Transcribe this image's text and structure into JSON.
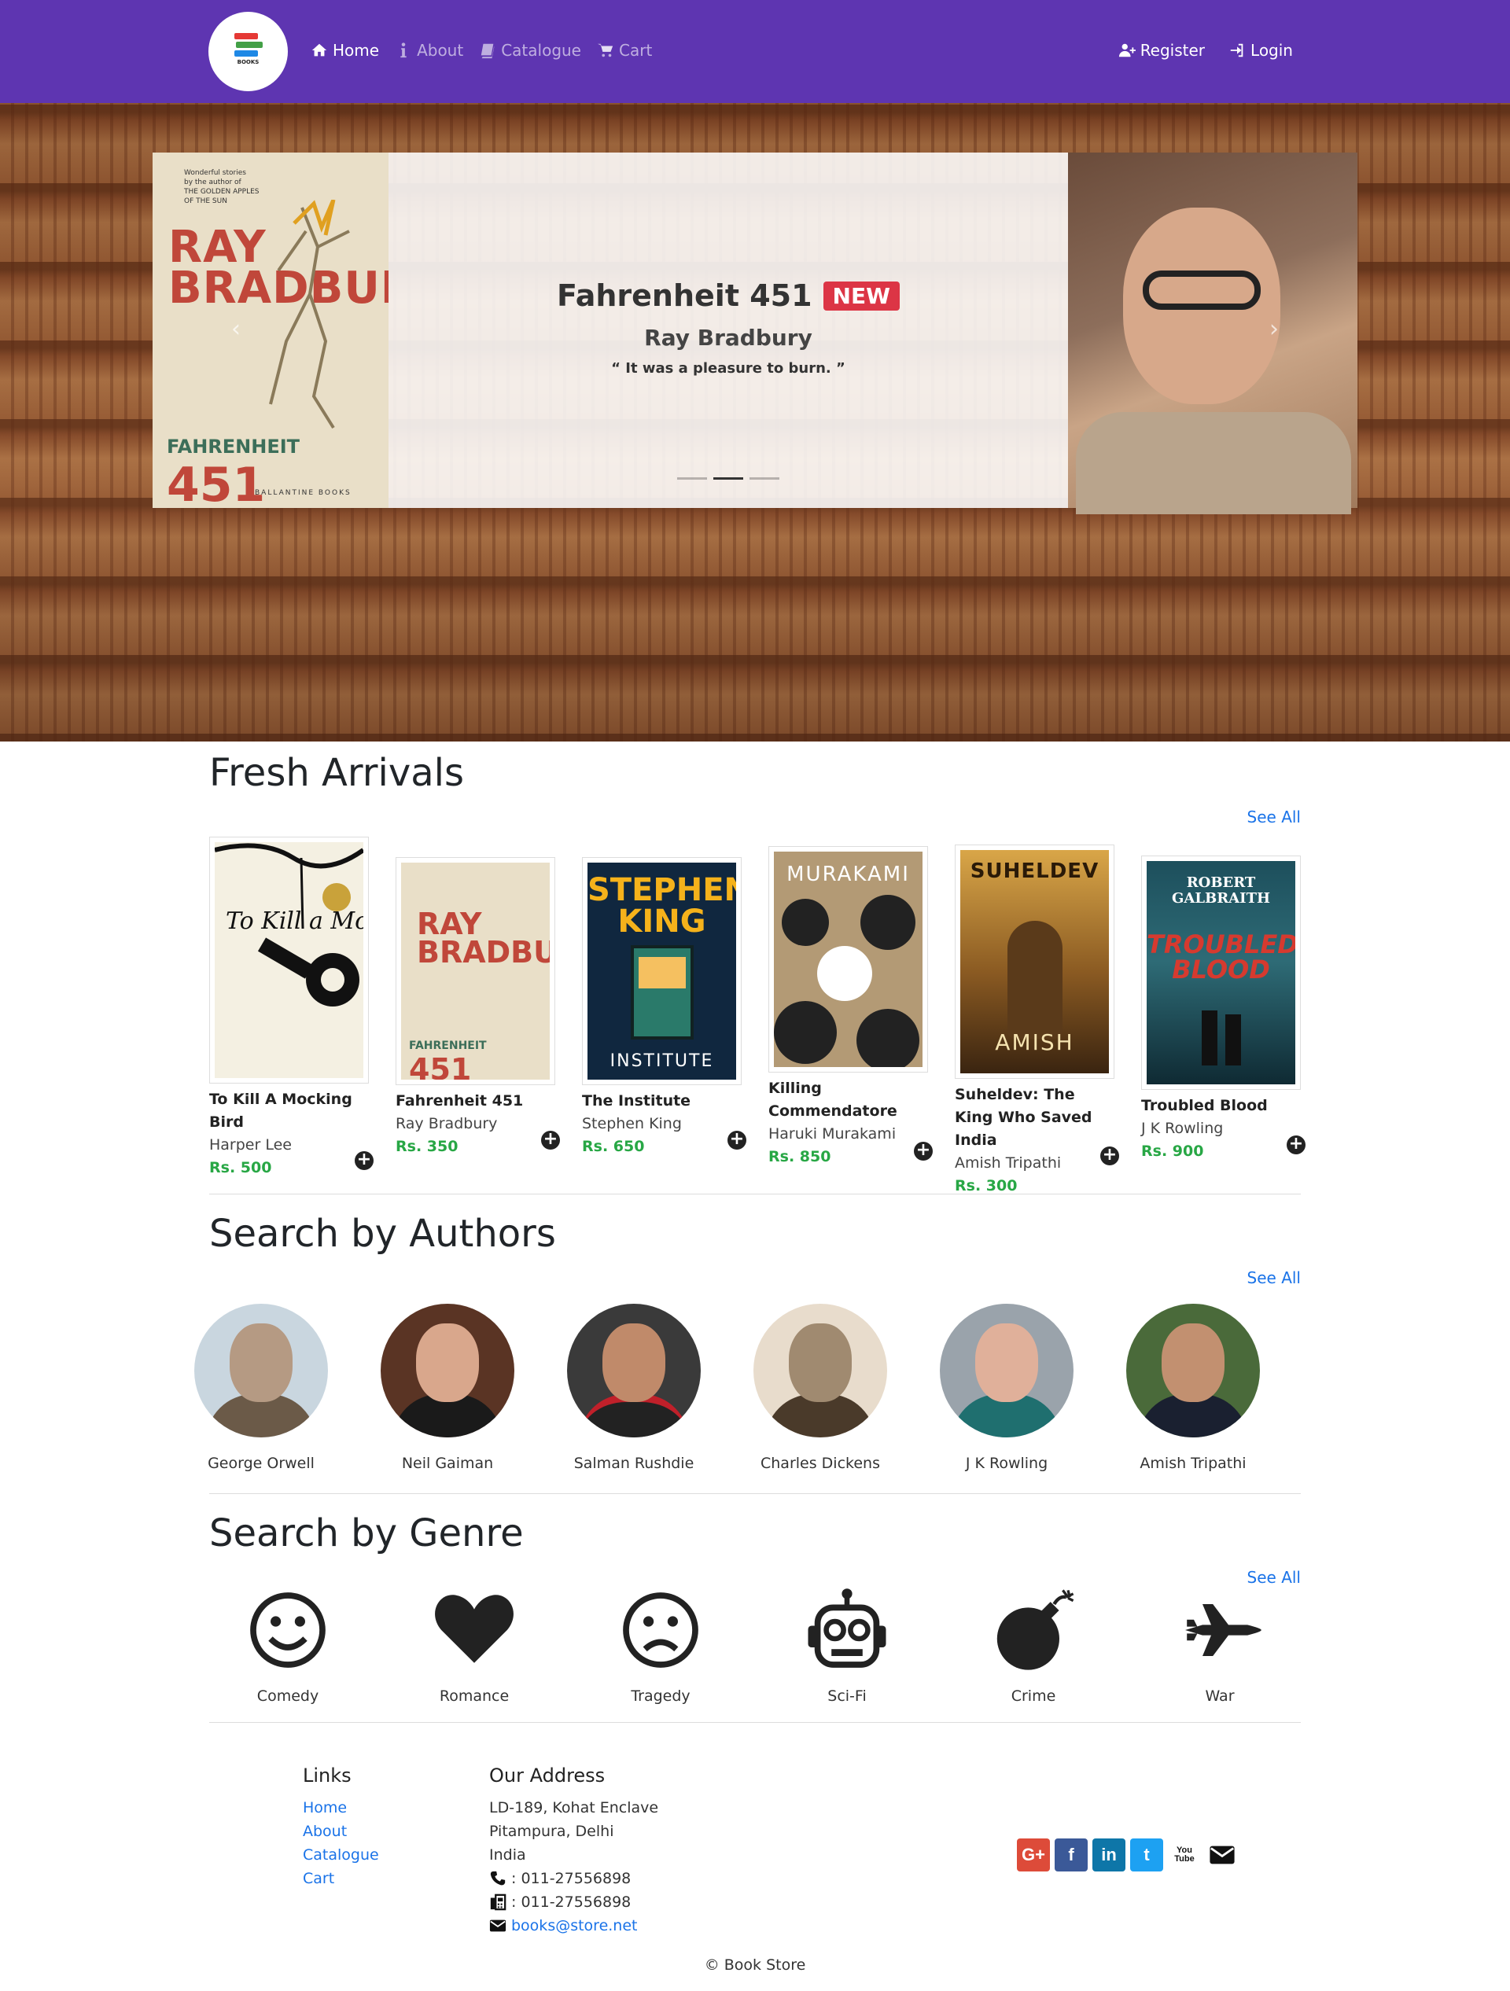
{
  "brand": {
    "logo_text": "BOOKS"
  },
  "nav": {
    "home": "Home",
    "about": "About",
    "catalogue": "Catalogue",
    "cart": "Cart",
    "register": "Register",
    "login": "Login"
  },
  "hero": {
    "title": "Fahrenheit 451",
    "badge": "NEW",
    "author": "Ray Bradbury",
    "quote": "“ It was a pleasure to burn. ”",
    "cover": {
      "top_text": "Wonderful stories\nby the author of\nTHE GOLDEN APPLES\nOF THE SUN",
      "author": "RAY BRADBURY",
      "word": "FAHRENHEIT",
      "number": "451",
      "publisher": "BALLANTINE BOOKS"
    },
    "active_slide": 2,
    "slide_count": 3
  },
  "fresh": {
    "title": "Fresh Arrivals",
    "see_all": "See All",
    "books": [
      {
        "name": "To Kill A Mocking Bird",
        "author": "Harper Lee",
        "price": "Rs. 500",
        "cover_text": "To Kill a Mockingbird"
      },
      {
        "name": "Fahrenheit 451",
        "author": "Ray Bradbury",
        "price": "Rs. 350",
        "cover_text": "RAY BRADBURY"
      },
      {
        "name": "The Institute",
        "author": "Stephen King",
        "price": "Rs. 650",
        "cover_text": "STEPHEN KING"
      },
      {
        "name": "Killing Commendatore",
        "author": "Haruki Murakami",
        "price": "Rs. 850",
        "cover_text": "MURAKAMI"
      },
      {
        "name": "Suheldev: The King Who Saved India",
        "author": "Amish Tripathi",
        "price": "Rs. 300",
        "cover_text": "SUHELDEV"
      },
      {
        "name": "Troubled Blood",
        "author": "J K Rowling",
        "price": "Rs. 900",
        "cover_text": "ROBERT GALBRAITH"
      }
    ]
  },
  "authors": {
    "title": "Search by Authors",
    "see_all": "See All",
    "items": [
      "George Orwell",
      "Neil Gaiman",
      "Salman Rushdie",
      "Charles Dickens",
      "J K Rowling",
      "Amish Tripathi"
    ]
  },
  "genre": {
    "title": "Search by Genre",
    "see_all": "See All",
    "items": [
      "Comedy",
      "Romance",
      "Tragedy",
      "Sci-Fi",
      "Crime",
      "War"
    ]
  },
  "footer": {
    "links_title": "Links",
    "links": [
      "Home",
      "About",
      "Catalogue",
      "Cart"
    ],
    "address_title": "Our Address",
    "address": [
      "LD-189, Kohat Enclave",
      "Pitampura, Delhi",
      "India"
    ],
    "phone": ": 011-27556898",
    "fax": ": 011-27556898",
    "email": "books@store.net",
    "copyright": "© Book Store",
    "social": [
      "G+",
      "f",
      "in",
      "t",
      "You\nTube",
      "mail"
    ]
  },
  "colors": {
    "nav_bg": "#5e35b1",
    "price": "#28a745",
    "link": "#1a73e8",
    "badge": "#dc3545"
  }
}
